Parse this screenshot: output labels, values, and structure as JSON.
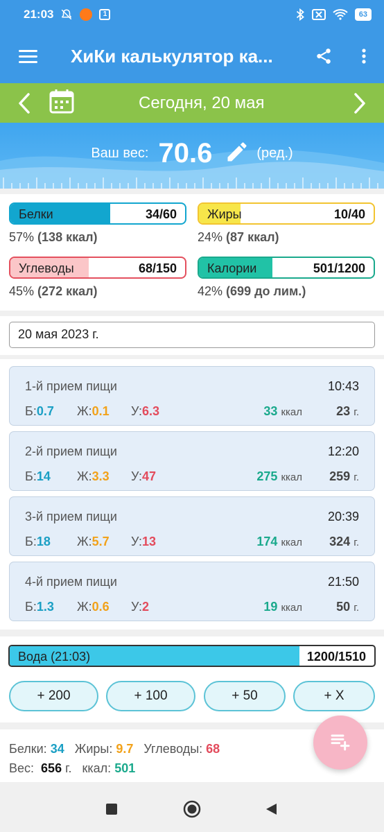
{
  "status_bar": {
    "time": "21:03",
    "small_box_label": "1",
    "battery": "63",
    "icons": [
      "muted-bell-icon",
      "orange-app-icon",
      "notification-box-icon",
      "bluetooth-icon",
      "no-sim-icon",
      "wifi-icon",
      "battery-icon"
    ]
  },
  "app_bar": {
    "title": "ХиКи калькулятор ка...",
    "menu_icon": "hamburger-menu-icon",
    "share_icon": "share-icon",
    "more_icon": "more-vertical-icon"
  },
  "date_bar": {
    "date": "Сегодня, 20 мая",
    "prev_icon": "chevron-left-icon",
    "next_icon": "chevron-right-icon",
    "calendar_icon": "calendar-icon"
  },
  "weight": {
    "label": "Ваш вес:",
    "value": "70.6",
    "edit_label": "(ред.)",
    "edit_icon": "pencil-icon"
  },
  "macros": {
    "protein": {
      "label": "Белки",
      "value": "34/60",
      "summary_percent": "57%",
      "summary_detail": "(138 ккал)",
      "fill": 0.57,
      "color": "#12a6cf"
    },
    "fat": {
      "label": "Жиры",
      "value": "10/40",
      "summary_percent": "24%",
      "summary_detail": "(87 ккал)",
      "fill": 0.24,
      "color": "#f7e64a"
    },
    "carbs": {
      "label": "Углеводы",
      "value": "68/150",
      "summary_percent": "45%",
      "summary_detail": "(272 ккал)",
      "fill": 0.45,
      "color": "#fbc6c8"
    },
    "calories": {
      "label": "Калории",
      "value": "501/1200",
      "summary_percent": "42%",
      "summary_detail": "(699 до лим.)",
      "fill": 0.42,
      "color": "#21c2a6"
    }
  },
  "date_field": {
    "value": "20 мая 2023 г."
  },
  "meals": [
    {
      "title": "1-й прием пищи",
      "time": "10:43",
      "p_label": "Б:",
      "p": "0.7",
      "f_label": "Ж:",
      "f": "0.1",
      "c_label": "У:",
      "c": "6.3",
      "kcal": "33",
      "kcal_unit": "ккал",
      "grams": "23",
      "grams_unit": "г."
    },
    {
      "title": "2-й прием пищи",
      "time": "12:20",
      "p_label": "Б:",
      "p": "14",
      "f_label": "Ж:",
      "f": "3.3",
      "c_label": "У:",
      "c": "47",
      "kcal": "275",
      "kcal_unit": "ккал",
      "grams": "259",
      "grams_unit": "г."
    },
    {
      "title": "3-й прием пищи",
      "time": "20:39",
      "p_label": "Б:",
      "p": "18",
      "f_label": "Ж:",
      "f": "5.7",
      "c_label": "У:",
      "c": "13",
      "kcal": "174",
      "kcal_unit": "ккал",
      "grams": "324",
      "grams_unit": "г."
    },
    {
      "title": "4-й прием пищи",
      "time": "21:50",
      "p_label": "Б:",
      "p": "1.3",
      "f_label": "Ж:",
      "f": "0.6",
      "c_label": "У:",
      "c": "2",
      "kcal": "19",
      "kcal_unit": "ккал",
      "grams": "50",
      "grams_unit": "г."
    }
  ],
  "water": {
    "label": "Вода (21:03)",
    "value": "1200/1510",
    "fill": 0.795,
    "buttons": [
      "+ 200",
      "+ 100",
      "+ 50",
      "+ X"
    ]
  },
  "totals": {
    "protein_label": "Белки:",
    "protein": "34",
    "fat_label": "Жиры:",
    "fat": "9.7",
    "carbs_label": "Углеводы:",
    "carbs": "68",
    "weight_label": "Вес:",
    "weight": "656",
    "weight_unit": "г.",
    "kcal_label": "ккал:",
    "kcal": "501"
  },
  "fab": {
    "icon": "playlist-add-icon"
  },
  "nav": {
    "recent_icon": "square-recents-icon",
    "home_icon": "circle-home-icon",
    "back_icon": "triangle-back-icon"
  }
}
